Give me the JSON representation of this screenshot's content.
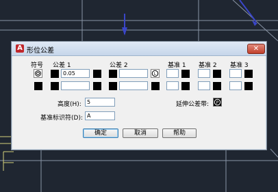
{
  "dialog": {
    "title": "形位公差",
    "close_label": "✕",
    "headers": {
      "symbol": "符号",
      "tol1": "公差 1",
      "tol2": "公差 2",
      "datum1": "基准 1",
      "datum2": "基准 2",
      "datum3": "基准 3"
    },
    "row1": {
      "tol1_value": "0.05",
      "tol2_value": ""
    },
    "row2": {
      "tol1_value": "",
      "tol2_value": ""
    },
    "height_label": "高度(H):",
    "height_value": "5",
    "datum_id_label": "基准标识符(D):",
    "datum_id_value": "A",
    "projected_zone_label": "延伸公差带:",
    "buttons": {
      "ok": "确定",
      "cancel": "取消",
      "help": "帮助"
    }
  },
  "colors": {
    "cad_bg": "#1f2631",
    "accent_blue": "#3a46c8",
    "cad_yellow": "#d6d27a"
  }
}
